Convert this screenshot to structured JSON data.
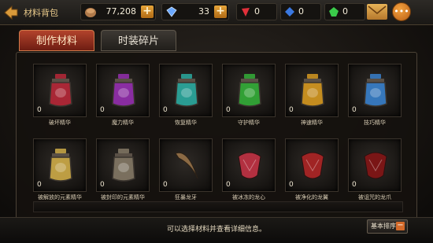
{
  "header": {
    "title": "材料背包",
    "coins": "77,208",
    "diamonds": "33",
    "gem_red": "0",
    "gem_blue": "0",
    "gem_green": "0"
  },
  "tabs": [
    {
      "label": "制作材料"
    },
    {
      "label": "时装碎片"
    }
  ],
  "items": [
    {
      "name": "破坏精华",
      "count": "0",
      "color": "#c0283a"
    },
    {
      "name": "魔力精华",
      "count": "0",
      "color": "#9b2fb8"
    },
    {
      "name": "恢复精华",
      "count": "0",
      "color": "#2bb3a8"
    },
    {
      "name": "守护精华",
      "count": "0",
      "color": "#34b63a"
    },
    {
      "name": "神速精华",
      "count": "0",
      "color": "#e0a020"
    },
    {
      "name": "技巧精华",
      "count": "0",
      "color": "#3a86d6"
    },
    {
      "name": "被解放的元素精华",
      "count": "0",
      "color": "#d8b44a"
    },
    {
      "name": "被封印的元素精华",
      "count": "0",
      "color": "#8a7e6a"
    },
    {
      "name": "狂暴龙牙",
      "count": "0",
      "color": "#8b6a44"
    },
    {
      "name": "被冰冻的龙心",
      "count": "0",
      "color": "#b23040"
    },
    {
      "name": "被净化的龙翼",
      "count": "0",
      "color": "#a02424"
    },
    {
      "name": "被诅咒的龙爪",
      "count": "0",
      "color": "#7a1616"
    }
  ],
  "footer": {
    "hint": "可以选择材料并查看详细信息。",
    "sort_label": "基本排序"
  }
}
